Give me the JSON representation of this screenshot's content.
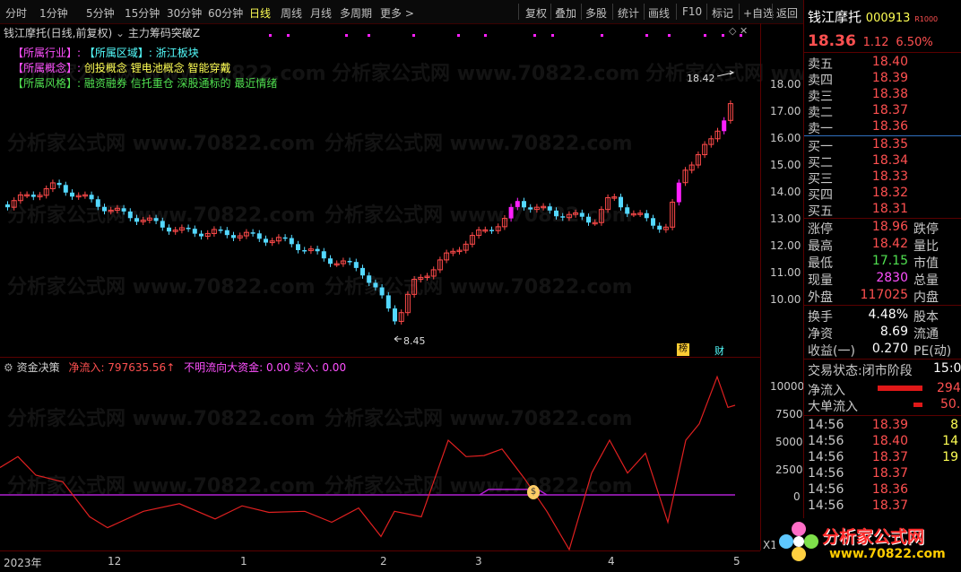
{
  "topbar": {
    "tabs": [
      "分时",
      "1分钟",
      "5分钟",
      "15分钟",
      "30分钟",
      "60分钟",
      "日线",
      "周线",
      "月线",
      "多周期",
      "更多 >"
    ],
    "active_tab": "日线",
    "buttons": [
      "复权",
      "叠加",
      "多股",
      "统计",
      "画线",
      "F10",
      "标记",
      "+自选",
      "返回"
    ]
  },
  "chart": {
    "title": "钱江摩托(日线,前复权)",
    "indicator_name": "主力筹码突破Z",
    "info_lines": [
      {
        "tag": "【所属行业】:",
        "tag2": "【所属区域】:",
        "text": "浙江板块"
      },
      {
        "tag": "【所属概念】:",
        "text": "创投概念 锂电池概念 智能穿戴"
      },
      {
        "tag": "【所属风格】:",
        "text": "融资融券 信托重仓 深股通标的 最近情绪"
      }
    ],
    "high_label": "18.42",
    "low_label": "8.45",
    "badge1": "榜",
    "badge2": "财",
    "price_ticks": [
      "18.00",
      "17.00",
      "16.00",
      "15.00",
      "14.00",
      "13.00",
      "12.00",
      "11.00",
      "10.00"
    ],
    "watermark": "分析家公式网 www.70822.com"
  },
  "indicator": {
    "name": "资金决策",
    "l1": "净流入: 797635.56",
    "l1_arrow": "↑",
    "l2": "不明流向大资金: 0.00",
    "l3": "买入: 0.00",
    "ticks": [
      "10000",
      "7500",
      "5000",
      "2500",
      "0"
    ],
    "x1": "X1"
  },
  "xaxis": [
    "2023年",
    "12",
    "1",
    "2",
    "3",
    "4",
    "5"
  ],
  "quote": {
    "name": "钱江摩托",
    "code": "000913",
    "flag": "R1000",
    "price": "18.36",
    "change": "1.12",
    "pct": "6.50%",
    "sell": [
      {
        "label": "卖五",
        "price": "18.40"
      },
      {
        "label": "卖四",
        "price": "18.39"
      },
      {
        "label": "卖三",
        "price": "18.38"
      },
      {
        "label": "卖二",
        "price": "18.37"
      },
      {
        "label": "卖一",
        "price": "18.36"
      }
    ],
    "buy": [
      {
        "label": "买一",
        "price": "18.35"
      },
      {
        "label": "买二",
        "price": "18.34"
      },
      {
        "label": "买三",
        "price": "18.33"
      },
      {
        "label": "买四",
        "price": "18.32"
      },
      {
        "label": "买五",
        "price": "18.31"
      }
    ],
    "stats": [
      {
        "l": "涨停",
        "v": "18.96",
        "c": "red",
        "r": "跌停"
      },
      {
        "l": "最高",
        "v": "18.42",
        "c": "red",
        "r": "量比"
      },
      {
        "l": "最低",
        "v": "17.15",
        "c": "grn",
        "r": "市值"
      },
      {
        "l": "现量",
        "v": "2830",
        "c": "mag",
        "r": "总量"
      },
      {
        "l": "外盘",
        "v": "117025",
        "c": "red",
        "r": "内盘"
      }
    ],
    "stats2": [
      {
        "l": "换手",
        "v": "4.48%",
        "r": "股本"
      },
      {
        "l": "净资",
        "v": "8.69",
        "r": "流通"
      },
      {
        "l": "收益(一)",
        "v": "0.270",
        "r": "PE(动)"
      }
    ],
    "status_label": "交易状态:",
    "status_value": "闭市阶段",
    "status_time": "15:00",
    "netflow_label": "净流入",
    "netflow_val": "294",
    "bigflow_label": "大单流入",
    "bigflow_val": "50.",
    "ticks": [
      {
        "t": "14:56",
        "p": "18.39",
        "v": "8"
      },
      {
        "t": "14:56",
        "p": "18.40",
        "v": "14"
      },
      {
        "t": "14:56",
        "p": "18.37",
        "v": "19"
      },
      {
        "t": "14:56",
        "p": "18.37",
        "v": ""
      },
      {
        "t": "14:56",
        "p": "18.36",
        "v": ""
      },
      {
        "t": "14:56",
        "p": "18.37",
        "v": ""
      }
    ],
    "logo_text": "分析家公式网",
    "logo_url": "www.70822.com"
  },
  "colors": {
    "up": "#ff4a4a",
    "down": "#54d8ff",
    "magenta": "#ff20ff",
    "bg": "#000000"
  }
}
